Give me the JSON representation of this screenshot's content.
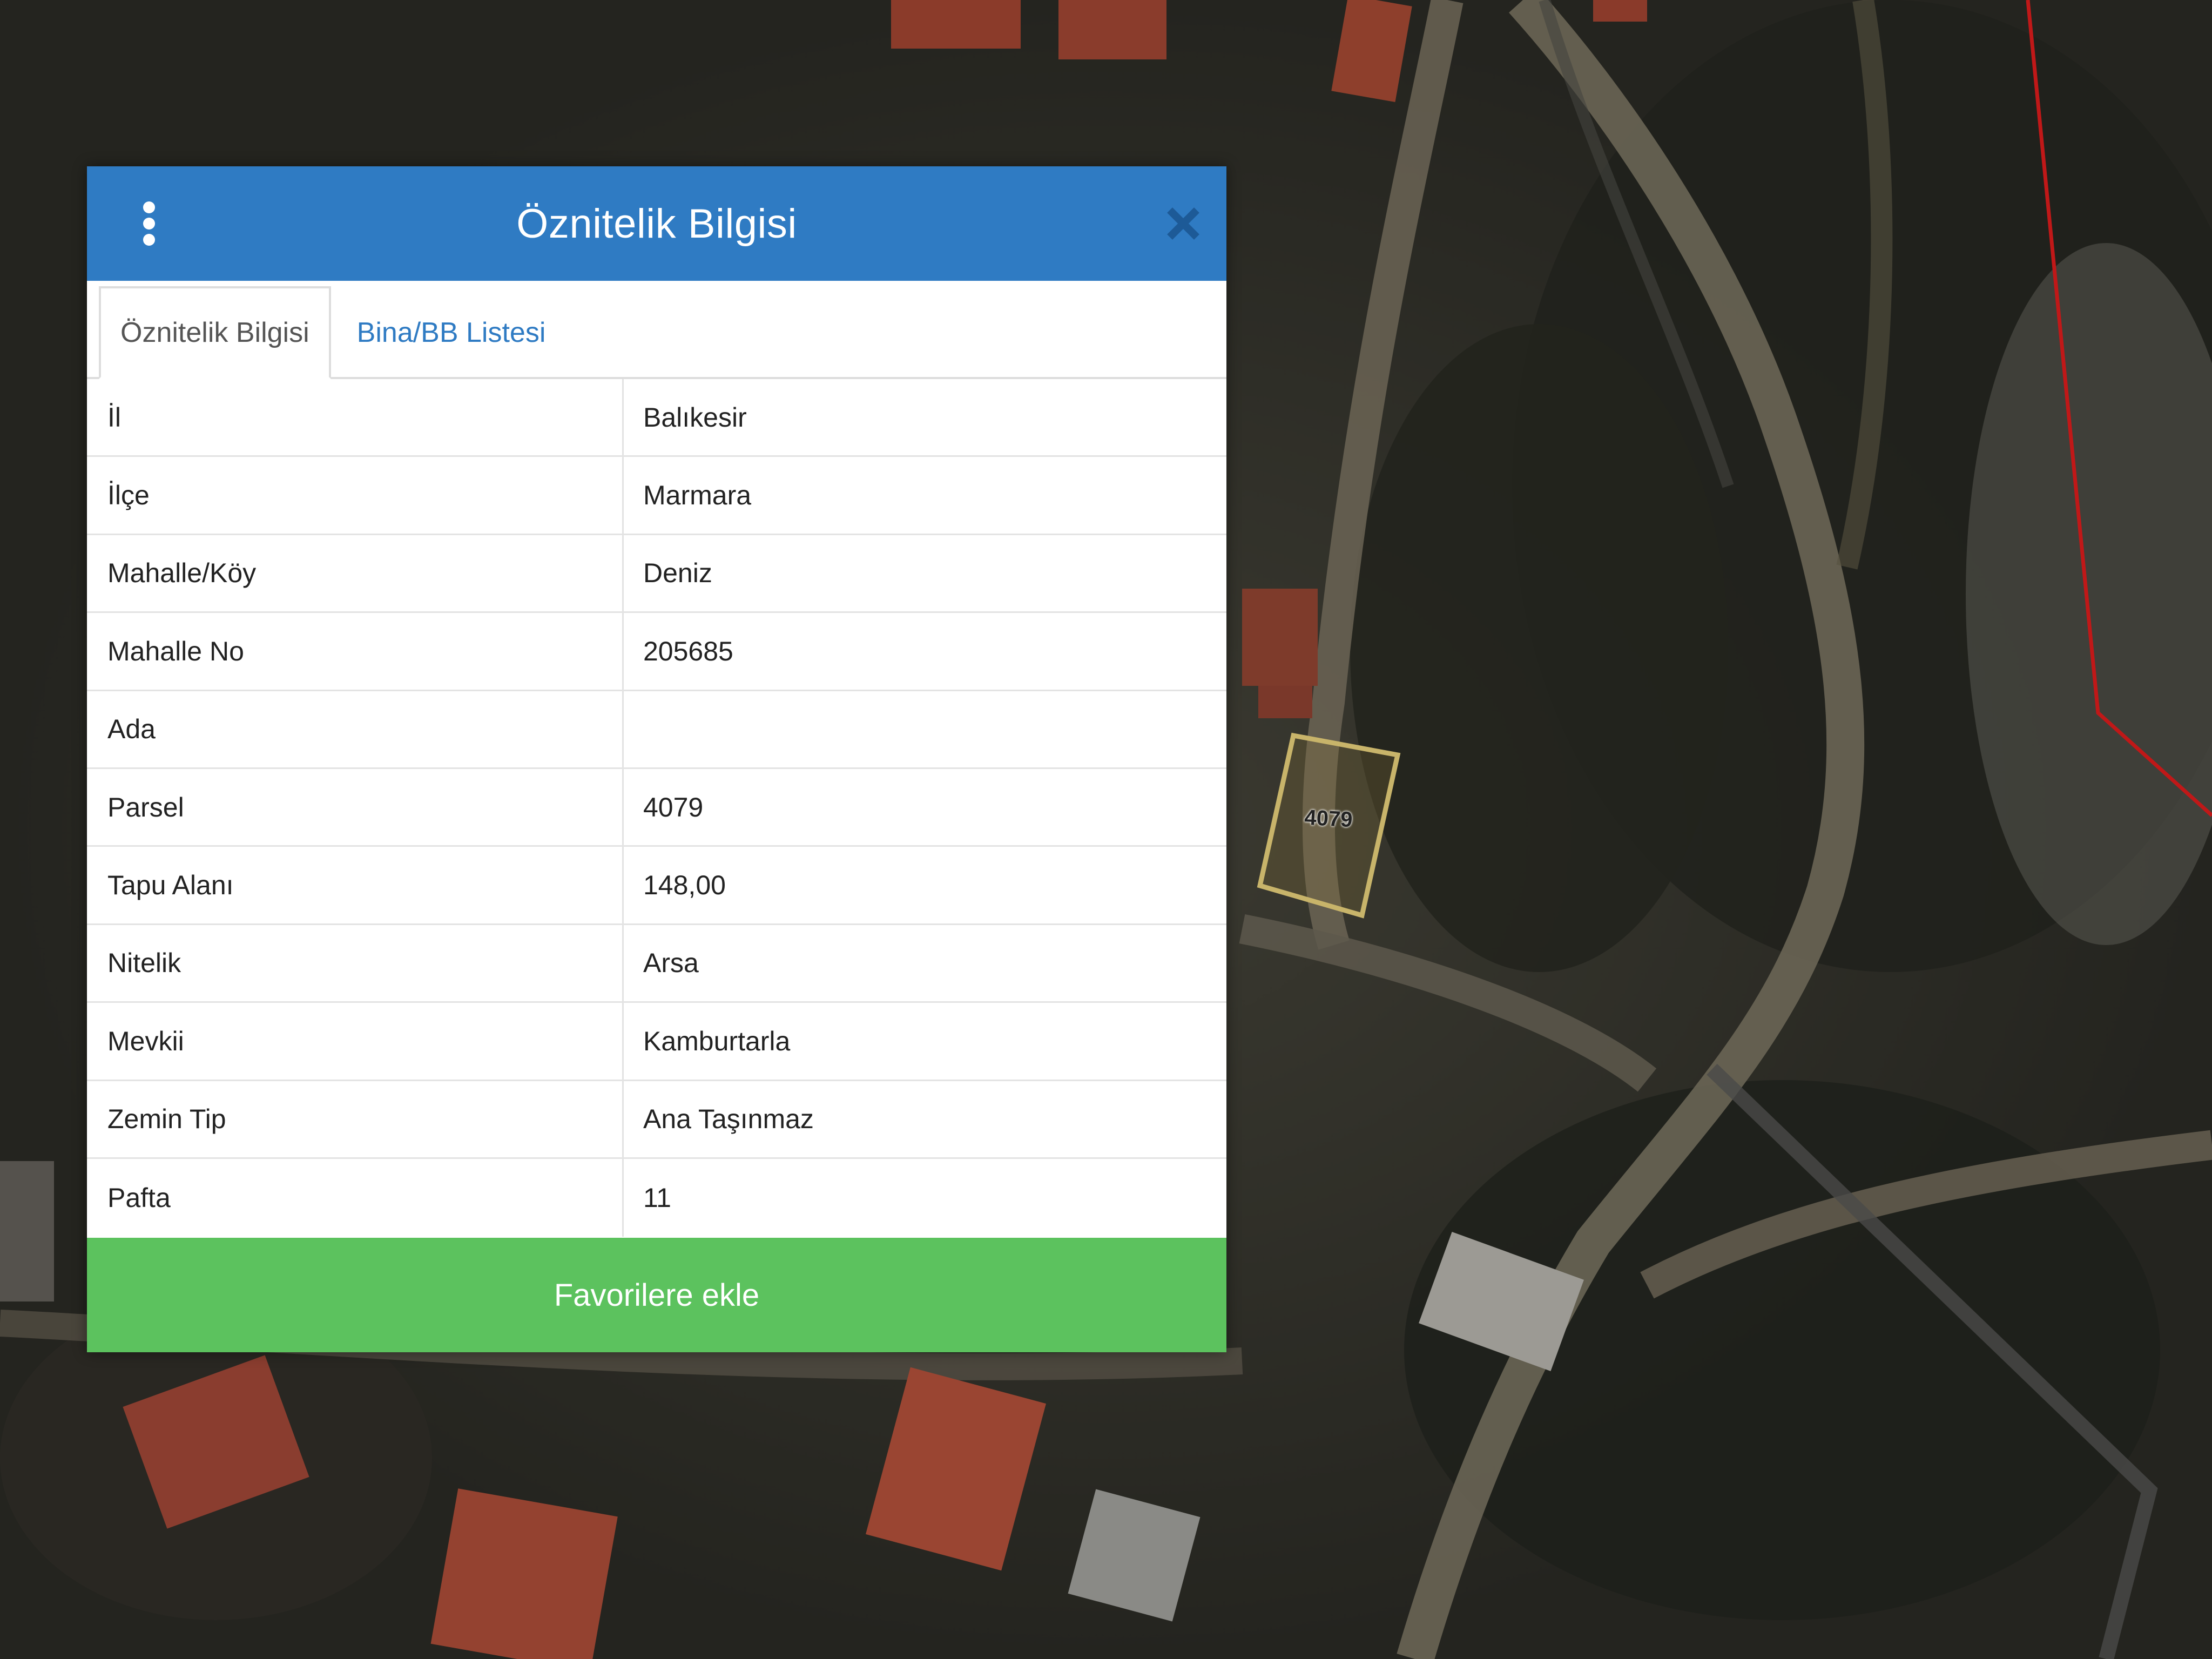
{
  "panel": {
    "title": "Öznitelik Bilgisi",
    "tabs": [
      {
        "label": "Öznitelik Bilgisi",
        "active": true
      },
      {
        "label": "Bina/BB Listesi",
        "active": false
      }
    ],
    "rows": [
      {
        "key": "İl",
        "value": "Balıkesir"
      },
      {
        "key": "İlçe",
        "value": "Marmara"
      },
      {
        "key": "Mahalle/Köy",
        "value": "Deniz"
      },
      {
        "key": "Mahalle No",
        "value": "205685"
      },
      {
        "key": "Ada",
        "value": ""
      },
      {
        "key": "Parsel",
        "value": "4079"
      },
      {
        "key": "Tapu Alanı",
        "value": "148,00"
      },
      {
        "key": "Nitelik",
        "value": "Arsa"
      },
      {
        "key": "Mevkii",
        "value": "Kamburtarla"
      },
      {
        "key": "Zemin Tip",
        "value": "Ana Taşınmaz"
      },
      {
        "key": "Pafta",
        "value": "11"
      }
    ],
    "favorite_button": "Favorilere ekle",
    "menu_icon": "kebab-menu-icon",
    "close_icon": "close-icon"
  },
  "map": {
    "parcel_label": "4079"
  },
  "colors": {
    "header": "#2f7bc3",
    "tab_link": "#2f7bc3",
    "favorite_button": "#5cc25e",
    "parcel_outline": "#c8b46a",
    "boundary_line": "#c01818"
  }
}
